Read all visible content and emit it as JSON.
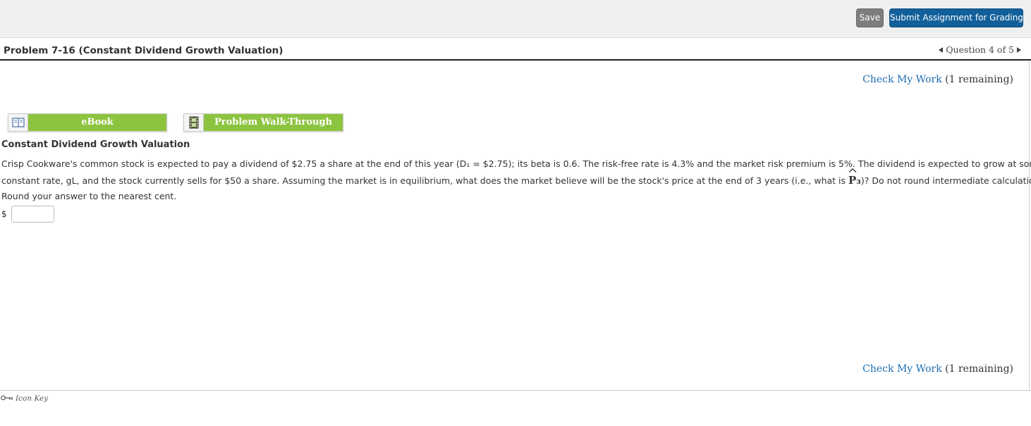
{
  "toolbar": {
    "save_label": "Save",
    "submit_label": "Submit Assignment for Grading"
  },
  "header": {
    "problem_title": "Problem 7-16 (Constant Dividend Growth Valuation)",
    "question_nav": "Question 4 of 5"
  },
  "check_work": {
    "link_label": "Check My Work",
    "remaining": "(1 remaining)"
  },
  "resources": {
    "ebook_label": "eBook",
    "ebook_icon": "book-icon",
    "walkthrough_label": "Problem Walk-Through",
    "walkthrough_icon": "film-icon",
    "accent_color": "#8dc43f"
  },
  "problem": {
    "section_title": "Constant Dividend Growth Valuation",
    "line1": "Crisp Cookware's common stock is expected to pay a dividend of $2.75 a share at the end of this year (D₁ = $2.75); its beta is 0.6. The risk-free rate is 4.3% and the market risk premium is 5%. The dividend is expected to grow at some",
    "line2a": "constant rate, gL, and the stock currently sells for $50 a share. Assuming the market is in equilibrium, what does the market believe will be the stock's price at the end of 3 years (i.e., what is ",
    "p3_symbol": "P₃",
    "line2b": ")? Do not round intermediate calculations.",
    "line3": "Round your answer to the nearest cent."
  },
  "answer": {
    "currency": "$",
    "value": ""
  },
  "footer": {
    "icon_key_label": "Icon Key",
    "icon": "key-icon"
  },
  "colors": {
    "submit_button": "#12609a",
    "save_button": "#7d7d7d",
    "link": "#1d6db2"
  }
}
